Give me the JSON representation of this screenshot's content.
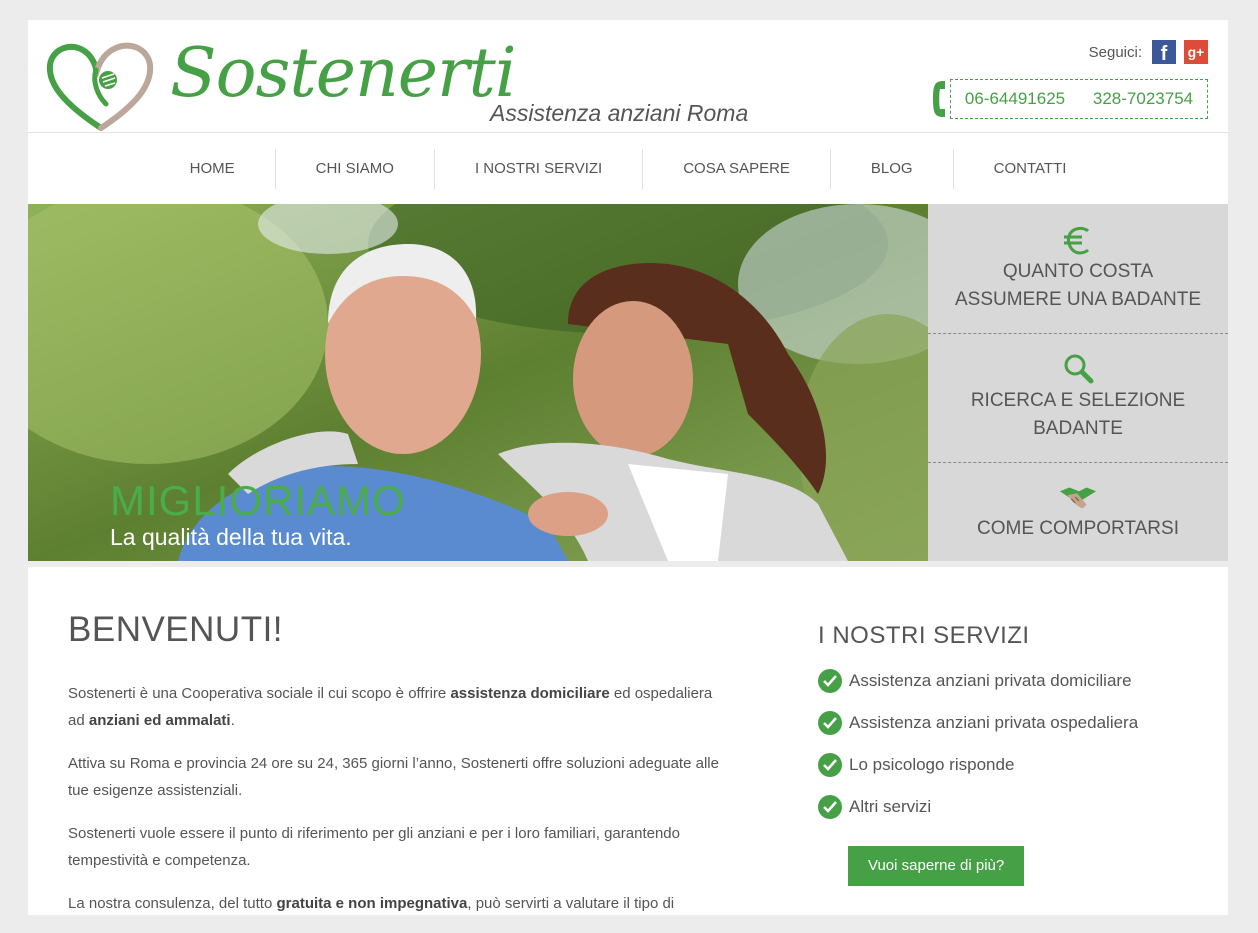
{
  "header": {
    "brand": "Sostenerti",
    "tagline": "Assistenza anziani Roma",
    "follow_label": "Seguici:",
    "facebook_glyph": "f",
    "googleplus_glyph": "g+",
    "phones": [
      "06-64491625",
      "328-7023754"
    ]
  },
  "nav": {
    "items": [
      "HOME",
      "CHI SIAMO",
      "I NOSTRI SERVIZI",
      "COSA SAPERE",
      "BLOG",
      "CONTATTI"
    ]
  },
  "hero": {
    "title": "MIGLIORIAMO",
    "subtitle": "La qualità della tua vita."
  },
  "sidebar": {
    "items": [
      {
        "label_line1": "QUANTO COSTA",
        "label_line2": "ASSUMERE UNA BADANTE",
        "icon": "euro-icon"
      },
      {
        "label_line1": "RICERCA E SELEZIONE",
        "label_line2": "BADANTE",
        "icon": "magnifier-icon"
      },
      {
        "label_line1": "COME COMPORTARSI",
        "label_line2": "",
        "icon": "handshake-icon"
      }
    ]
  },
  "main": {
    "welcome": "BENVENUTI!",
    "p1_a": "Sostenerti è una Cooperativa sociale il cui scopo è offrire ",
    "p1_b": "assistenza domiciliare",
    "p1_c": " ed ospedaliera ad ",
    "p1_d": "anziani ed ammalati",
    "p1_e": ".",
    "p2": "Attiva su Roma e provincia 24 ore su 24, 365 giorni l’anno, Sostenerti offre soluzioni adeguate alle tue esigenze assistenziali.",
    "p3": "Sostenerti vuole essere il punto di riferimento per gli anziani e per i loro familiari, garantendo tempestività e competenza.",
    "p4_a": "La nostra consulenza, del tutto ",
    "p4_b": "gratuita e non impegnativa",
    "p4_c": ", può servirti a valutare il tipo di"
  },
  "services": {
    "title": "I NOSTRI SERVIZI",
    "items": [
      "Assistenza anziani privata domiciliare",
      "Assistenza anziani privata ospedaliera",
      "Lo psicologo risponde",
      "Altri servizi"
    ],
    "cta": "Vuoi saperne di più?"
  },
  "colors": {
    "brand_green": "#46a046",
    "text_gray": "#555555",
    "sidebar_bg": "#d8d8d8",
    "page_bg": "#ececec"
  }
}
